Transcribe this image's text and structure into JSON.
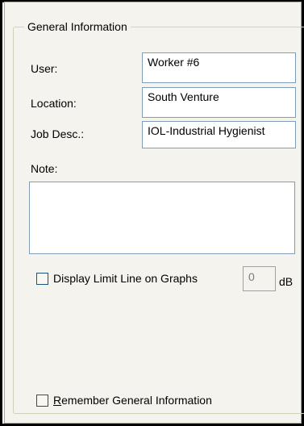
{
  "group": {
    "title": "General Information"
  },
  "fields": [
    {
      "label": "User:",
      "value": "Worker #6"
    },
    {
      "label": "Location:",
      "value": "South Venture"
    },
    {
      "label": "Job Desc.:",
      "value": "IOL-Industrial Hygienist"
    }
  ],
  "note": {
    "label": "Note:",
    "value": ""
  },
  "limit_line": {
    "label": "Display Limit Line on Graphs",
    "checked": false,
    "value": "0",
    "unit": "dB"
  },
  "remember": {
    "label_mnemonic": "R",
    "label_rest": "emember General Information",
    "checked": false
  },
  "colors": {
    "panel": "#f4f3ee",
    "field_border": "#7f9db9",
    "group_border": "#d0d0bf"
  }
}
